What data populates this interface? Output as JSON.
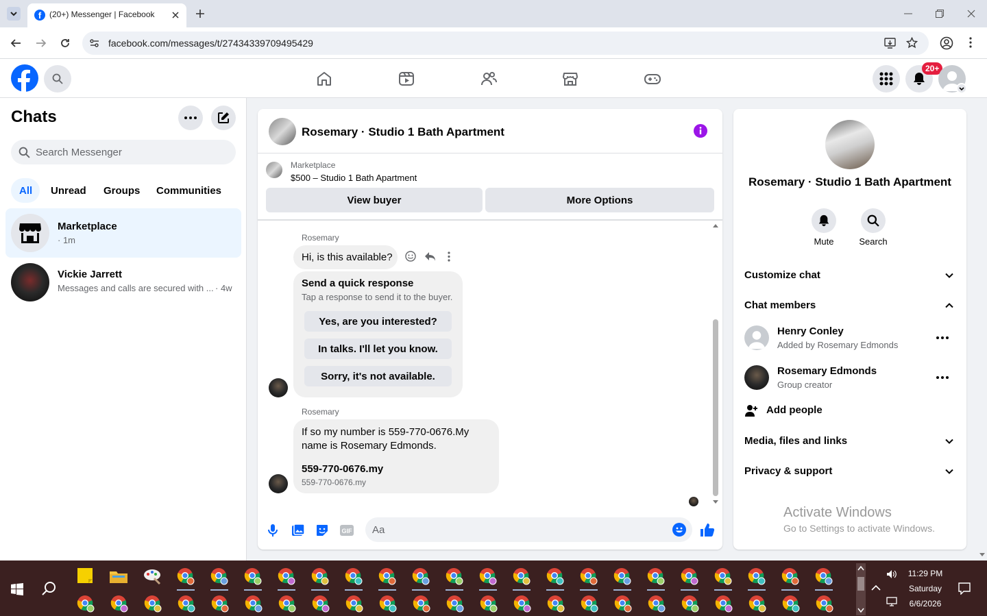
{
  "browser": {
    "tab_title": "(20+) Messenger | Facebook",
    "url": "facebook.com/messages/t/27434339709495429"
  },
  "fbheader": {
    "notif_badge": "20+"
  },
  "sidebar": {
    "title": "Chats",
    "search_placeholder": "Search Messenger",
    "filters": [
      "All",
      "Unread",
      "Groups",
      "Communities"
    ],
    "chats": [
      {
        "name": "Marketplace",
        "preview": "· 1m"
      },
      {
        "name": "Vickie Jarrett",
        "preview": "Messages and calls are secured with ...",
        "time": "· 4w"
      }
    ]
  },
  "conversation": {
    "title": "Rosemary · Studio 1 Bath Apartment",
    "listing_source": "Marketplace",
    "listing_title": "$500 – Studio 1 Bath Apartment",
    "view_buyer": "View buyer",
    "more_options": "More Options",
    "sender1": "Rosemary",
    "msg1": "Hi, is this available?",
    "quick_title": "Send a quick response",
    "quick_sub": "Tap a response to send it to the buyer.",
    "quick_replies": [
      "Yes, are you interested?",
      "In talks. I'll let you know.",
      "Sorry, it's not available."
    ],
    "sender2": "Rosemary",
    "msg2_line1": "If so my number is 559-770-0676.My",
    "msg2_line2": "name is Rosemary Edmonds.",
    "link_title": "559-770-0676.my",
    "link_sub": "559-770-0676.my",
    "composer_placeholder": "Aa"
  },
  "details": {
    "title": "Rosemary · Studio 1 Bath Apartment",
    "mute": "Mute",
    "search": "Search",
    "customize": "Customize chat",
    "members_header": "Chat members",
    "members": [
      {
        "name": "Henry Conley",
        "sub": "Added by Rosemary Edmonds"
      },
      {
        "name": "Rosemary Edmonds",
        "sub": "Group creator"
      }
    ],
    "add_people": "Add people",
    "media": "Media, files and links",
    "privacy": "Privacy & support",
    "watermark_title": "Activate Windows",
    "watermark_sub": "Go to Settings to activate Windows."
  },
  "taskbar": {
    "time": "11:29 PM",
    "day": "Saturday",
    "date": "6/6/2026"
  },
  "colors": {
    "fb_blue": "#0866ff",
    "badge_red": "#e41e3f",
    "purple_info": "#9b15e8"
  }
}
